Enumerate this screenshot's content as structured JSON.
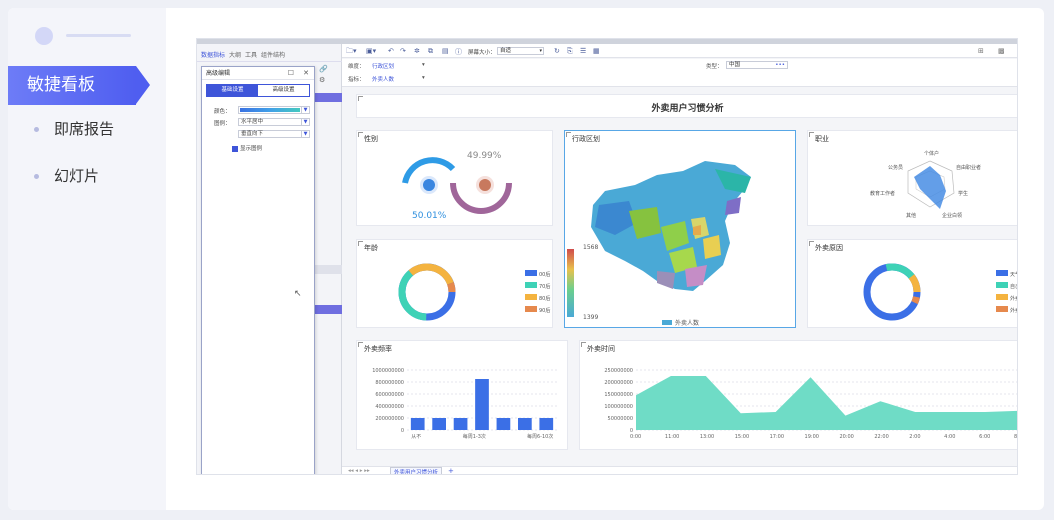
{
  "nav": {
    "active": "敏捷看板",
    "items": [
      "即席报告",
      "幻灯片"
    ]
  },
  "screenshot": {
    "left_tabs": [
      "数据指标",
      "大纲",
      "工具",
      "组件结构"
    ],
    "dialog": {
      "title": "高级编辑",
      "tab_basic": "基础设置",
      "tab_advanced": "高级设置",
      "color_label": "颜色：",
      "layout_label": "图例：",
      "layout_value": "水平居中",
      "pos_value": "垂直向下",
      "show_legend": "显示图例"
    },
    "toolbar": {
      "screen_label": "屏幕大小：",
      "screen_value": "自适"
    },
    "controls": {
      "dim_label": "维度：",
      "dim_value": "行政区划",
      "metric_label": "指标：",
      "metric_value": "外卖人数",
      "type_label": "类型：",
      "type_value": "中国"
    },
    "dashboard_title": "外卖用户习惯分析",
    "panels": {
      "gender": {
        "title": "性别",
        "female_pct": "49.99%",
        "male_pct": "50.01%"
      },
      "region": {
        "title": "行政区划",
        "max": "1568",
        "min": "1399",
        "legend": "外卖人数"
      },
      "job": {
        "title": "职业",
        "labels": [
          "个体户",
          "自由职业者",
          "学生",
          "企业白领",
          "其他",
          "教育工作者",
          "公务员"
        ]
      },
      "age": {
        "title": "年龄",
        "legend": [
          "00后",
          "70后",
          "80后",
          "90后"
        ]
      },
      "reason": {
        "title": "外卖原因",
        "legend": [
          "天气",
          "自己",
          "外卖",
          "外卖"
        ]
      },
      "freq": {
        "title": "外卖频率"
      },
      "time": {
        "title": "外卖时间"
      }
    },
    "sheet_tab": "外卖用户习惯分析"
  },
  "chart_data": [
    {
      "type": "bar",
      "title": "外卖频率",
      "categories": [
        "从不",
        "",
        "每周1-3次",
        "",
        "",
        "每周6-10次",
        ""
      ],
      "values": [
        200000000,
        200000000,
        200000000,
        850000000,
        200000000,
        200000000,
        200000000
      ],
      "yticks": [
        "1000000000",
        "800000000",
        "600000000",
        "400000000",
        "200000000",
        "0"
      ],
      "ylim": [
        0,
        1000000000
      ],
      "xlabels": [
        "从不",
        "每周1-3次",
        "每周6-10次"
      ]
    },
    {
      "type": "area",
      "title": "外卖时间",
      "x": [
        "0:00",
        "11:00",
        "13:00",
        "15:00",
        "17:00",
        "19:00",
        "20:00",
        "22:00",
        "2:00",
        "4:00",
        "6:00",
        "8:00"
      ],
      "values": [
        145000000,
        225000000,
        225000000,
        70000000,
        75000000,
        220000000,
        60000000,
        120000000,
        75000000,
        75000000,
        75000000,
        80000000
      ],
      "yticks": [
        "250000000",
        "200000000",
        "150000000",
        "100000000",
        "50000000",
        "0"
      ],
      "ylim": [
        0,
        250000000
      ]
    }
  ]
}
